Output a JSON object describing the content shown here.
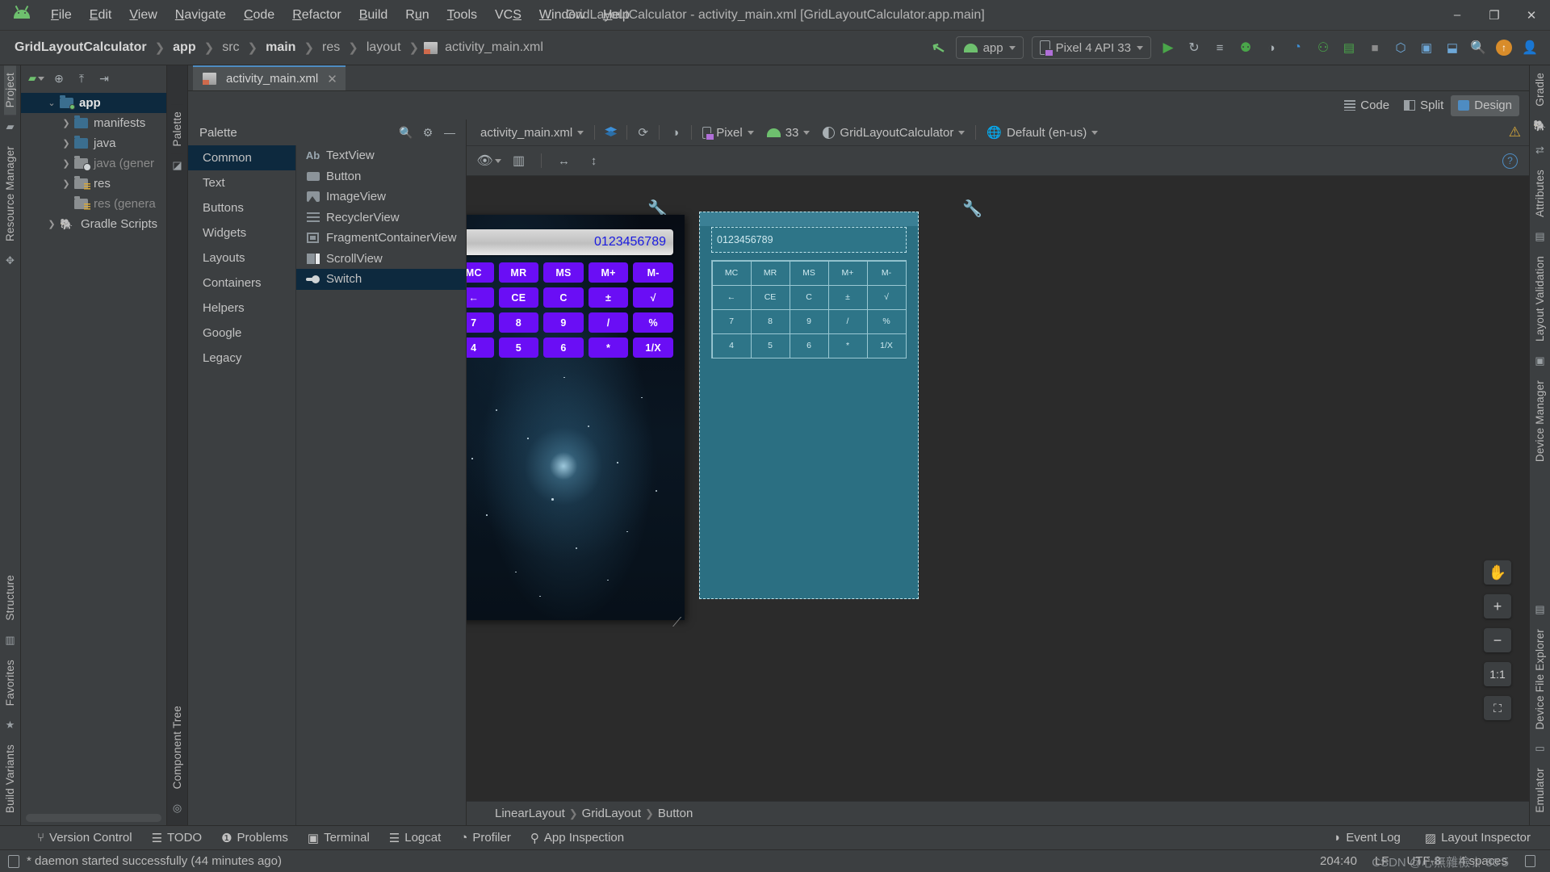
{
  "window": {
    "title": "GridLayoutCalculator - activity_main.xml [GridLayoutCalculator.app.main]",
    "minimize": "–",
    "maximize": "❐",
    "close": "✕"
  },
  "menubar": {
    "items": [
      {
        "label": "File",
        "mnemonic": "F"
      },
      {
        "label": "Edit",
        "mnemonic": "E"
      },
      {
        "label": "View",
        "mnemonic": "V"
      },
      {
        "label": "Navigate",
        "mnemonic": "N"
      },
      {
        "label": "Code",
        "mnemonic": "C"
      },
      {
        "label": "Refactor",
        "mnemonic": "R"
      },
      {
        "label": "Build",
        "mnemonic": "B"
      },
      {
        "label": "Run",
        "mnemonic": "u"
      },
      {
        "label": "Tools",
        "mnemonic": "T"
      },
      {
        "label": "VCS",
        "mnemonic": "S"
      },
      {
        "label": "Window",
        "mnemonic": "W"
      },
      {
        "label": "Help",
        "mnemonic": "H"
      }
    ]
  },
  "breadcrumb": {
    "items": [
      "GridLayoutCalculator",
      "app",
      "src",
      "main",
      "res",
      "layout",
      "activity_main.xml"
    ],
    "separator": "❯"
  },
  "toolbar": {
    "module_selector": "app",
    "device_selector": "Pixel 4 API 33",
    "icons": [
      "make-project-icon",
      "run-icon",
      "apply-changes-icon",
      "apply-code-changes-icon",
      "debug-icon",
      "run-with-coverage-icon",
      "profile-icon",
      "device-manager-icon",
      "stop-icon",
      "sdk-manager-icon",
      "avd-manager-icon",
      "layout-inspector-icon",
      "search-everywhere-icon",
      "notifications-icon",
      "account-icon"
    ]
  },
  "left_rail": {
    "top": [
      "Project",
      "Resource Manager"
    ],
    "bottom": [
      "Structure",
      "Favorites",
      "Build Variants"
    ]
  },
  "right_rail": {
    "items": [
      "Gradle",
      "Attributes",
      "Layout Validation",
      "Device Manager",
      "Device File Explorer",
      "Emulator"
    ]
  },
  "project_tree": {
    "toolbar_icons": [
      "android-view-icon",
      "collapse-icon",
      "expand-icon",
      "settings-icon",
      "hide-icon"
    ],
    "nodes": [
      {
        "label": "app",
        "bold": true,
        "selected": true,
        "arrow": "⌄",
        "icon": "folder-module",
        "depth": 0
      },
      {
        "label": "manifests",
        "arrow": "❯",
        "icon": "folder-blue",
        "depth": 1
      },
      {
        "label": "java",
        "arrow": "❯",
        "icon": "folder-blue",
        "depth": 1
      },
      {
        "label": "java (gener",
        "arrow": "❯",
        "icon": "folder-generated",
        "dim": true,
        "depth": 1
      },
      {
        "label": "res",
        "arrow": "❯",
        "icon": "folder-res",
        "depth": 1
      },
      {
        "label": "res (genera",
        "arrow": "",
        "icon": "folder-res",
        "dim": true,
        "depth": 1
      },
      {
        "label": "Gradle Scripts",
        "arrow": "❯",
        "icon": "gradle-elephant",
        "depth": 0
      }
    ]
  },
  "editor": {
    "tab": {
      "label": "activity_main.xml",
      "close": "✕",
      "icon": "xml-file-icon"
    },
    "modes": [
      {
        "label": "Code",
        "active": false,
        "icon": "code-mode-icon"
      },
      {
        "label": "Split",
        "active": false,
        "icon": "split-mode-icon"
      },
      {
        "label": "Design",
        "active": true,
        "icon": "design-mode-icon"
      }
    ]
  },
  "palette": {
    "title": "Palette",
    "header_icons": [
      "search-icon",
      "gear-icon",
      "minimize-icon"
    ],
    "categories": [
      {
        "label": "Common",
        "selected": true
      },
      {
        "label": "Text",
        "selected": false
      },
      {
        "label": "Buttons",
        "selected": false
      },
      {
        "label": "Widgets",
        "selected": false
      },
      {
        "label": "Layouts",
        "selected": false
      },
      {
        "label": "Containers",
        "selected": false
      },
      {
        "label": "Helpers",
        "selected": false
      },
      {
        "label": "Google",
        "selected": false
      },
      {
        "label": "Legacy",
        "selected": false
      }
    ],
    "items": [
      {
        "label": "TextView",
        "icon": "textview-icon",
        "selected": false
      },
      {
        "label": "Button",
        "icon": "button-icon",
        "selected": false
      },
      {
        "label": "ImageView",
        "icon": "imageview-icon",
        "selected": false
      },
      {
        "label": "RecyclerView",
        "icon": "recyclerview-icon",
        "selected": false
      },
      {
        "label": "FragmentContainerView",
        "icon": "fragment-icon",
        "selected": false
      },
      {
        "label": "ScrollView",
        "icon": "scrollview-icon",
        "selected": false
      },
      {
        "label": "Switch",
        "icon": "switch-icon",
        "selected": true
      }
    ]
  },
  "design_toolbar": {
    "file_selector": "activity_main.xml",
    "view_icons": [
      "design-surface-icon",
      "orientation-icon",
      "night-mode-icon"
    ],
    "device": "Pixel",
    "api_level": "33",
    "theme": "GridLayoutCalculator",
    "locale": "Default (en-us)",
    "warning_icon": "warning-triangle-icon",
    "row2_icons": [
      "eye-icon",
      "panels-icon",
      "horizontal-constraint-icon",
      "vertical-constraint-icon"
    ],
    "help_icon": "help-circle-icon"
  },
  "preview": {
    "display_value": "0123456789",
    "keys": [
      "MC",
      "MR",
      "MS",
      "M+",
      "M-",
      "←",
      "CE",
      "C",
      "±",
      "√",
      "7",
      "8",
      "9",
      "/",
      "%",
      "4",
      "5",
      "6",
      "*",
      "1/X"
    ],
    "wrench_icon": "wrench-icon"
  },
  "blueprint": {
    "display_value": "0123456789",
    "keys": [
      "MC",
      "MR",
      "MS",
      "M+",
      "M-",
      "←",
      "CE",
      "C",
      "±",
      "√",
      "7",
      "8",
      "9",
      "/",
      "%",
      "4",
      "5",
      "6",
      "*",
      "1/X"
    ],
    "wrench_icon": "wrench-icon"
  },
  "zoom_controls": {
    "pan": "✋",
    "zoom_in": "+",
    "zoom_out": "−",
    "actual_size": "1:1",
    "fit_screen": "⛶"
  },
  "component_tree_rail": "Component Tree",
  "bottom_breadcrumb": {
    "items": [
      "LinearLayout",
      "GridLayout",
      "Button"
    ],
    "separator": "❯"
  },
  "tool_windows": {
    "left": [
      {
        "label": "Version Control",
        "icon": "branch-icon"
      },
      {
        "label": "TODO",
        "icon": "todo-list-icon"
      },
      {
        "label": "Problems",
        "icon": "problems-icon"
      },
      {
        "label": "Terminal",
        "icon": "terminal-icon"
      },
      {
        "label": "Logcat",
        "icon": "logcat-icon"
      },
      {
        "label": "Profiler",
        "icon": "profiler-icon"
      },
      {
        "label": "App Inspection",
        "icon": "app-inspection-icon"
      }
    ],
    "right": [
      {
        "label": "Event Log",
        "icon": "event-log-icon"
      },
      {
        "label": "Layout Inspector",
        "icon": "layout-inspector-icon"
      }
    ]
  },
  "statusbar": {
    "message": "* daemon started successfully (44 minutes ago)",
    "caret_position": "204:40",
    "line_separator": "LF",
    "encoding": "UTF-8",
    "indent": "4 spaces",
    "lock_icon": "lock-icon",
    "watermark": "CSDN @心無雜檢☆ 86５"
  },
  "colors": {
    "accent_blue": "#4e8cc2",
    "selection": "#0d293e",
    "key_purple": "#6a0ef5",
    "blueprint": "#2b6f82",
    "android_green": "#6ec06e"
  }
}
